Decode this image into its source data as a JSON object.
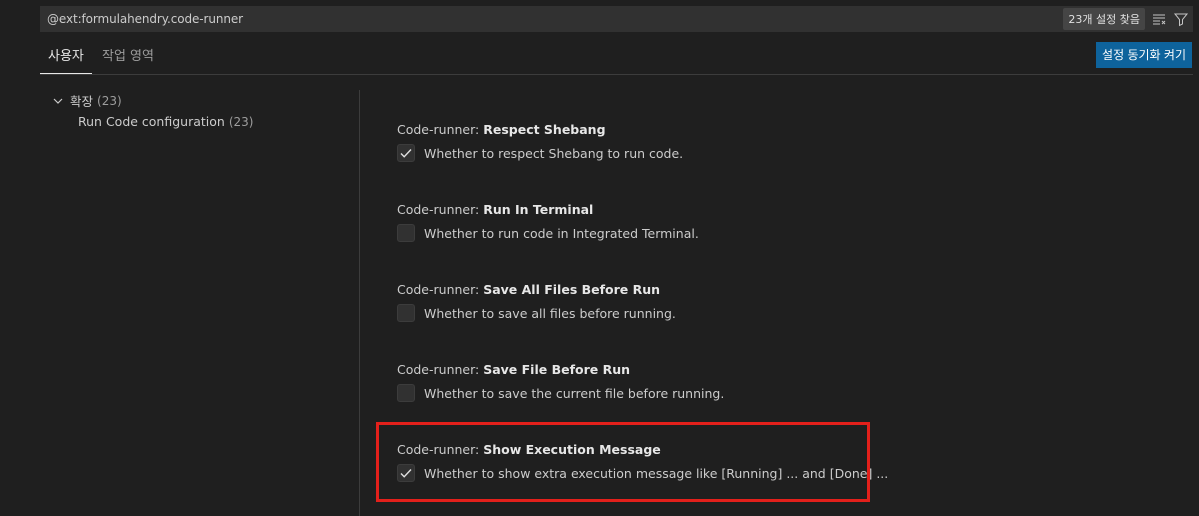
{
  "search": {
    "value": "@ext:formulahendry.code-runner",
    "result_count": "23개 설정 찾음",
    "clear_filter_icon": "clear-filter-icon",
    "filter_icon": "filter-icon"
  },
  "tabs": [
    {
      "label": "사용자",
      "active": true
    },
    {
      "label": "작업 영역",
      "active": false
    }
  ],
  "sync_button": {
    "label": "설정 동기화 켜기"
  },
  "toc": {
    "group": {
      "label": "확장",
      "count": "(23)",
      "icon": "chevron-down-icon"
    },
    "item": {
      "label": "Run Code configuration",
      "count": "(23)"
    }
  },
  "settings": [
    {
      "category": "Code-runner: ",
      "name": "Respect Shebang",
      "description": "Whether to respect Shebang to run code.",
      "checked": true
    },
    {
      "category": "Code-runner: ",
      "name": "Run In Terminal",
      "description": "Whether to run code in Integrated Terminal.",
      "checked": false
    },
    {
      "category": "Code-runner: ",
      "name": "Save All Files Before Run",
      "description": "Whether to save all files before running.",
      "checked": false
    },
    {
      "category": "Code-runner: ",
      "name": "Save File Before Run",
      "description": "Whether to save the current file before running.",
      "checked": false
    },
    {
      "category": "Code-runner: ",
      "name": "Show Execution Message",
      "description": "Whether to show extra execution message like [Running] ... and [Done] ...",
      "checked": true
    }
  ],
  "colors": {
    "background": "#1f1f1f",
    "accent_button": "#0e639c",
    "highlight_box": "#e3201b"
  }
}
